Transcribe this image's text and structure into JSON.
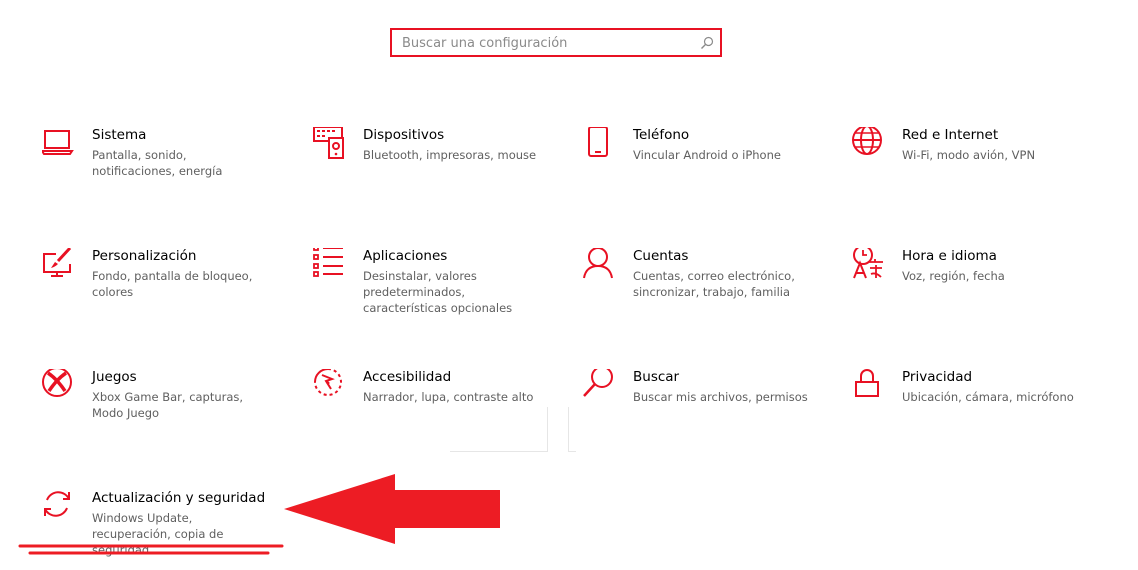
{
  "search": {
    "placeholder": "Buscar una configuración"
  },
  "colors": {
    "accent": "#e81123",
    "annotation": "#ed1c24"
  },
  "tiles": [
    {
      "title": "Sistema",
      "desc": "Pantalla, sonido, notificaciones, energía",
      "icon": "laptop-icon"
    },
    {
      "title": "Dispositivos",
      "desc": "Bluetooth, impresoras, mouse",
      "icon": "keyboard-speaker-icon"
    },
    {
      "title": "Teléfono",
      "desc": "Vincular Android o iPhone",
      "icon": "phone-icon"
    },
    {
      "title": "Red e Internet",
      "desc": "Wi-Fi, modo avión, VPN",
      "icon": "globe-icon"
    },
    {
      "title": "Personalización",
      "desc": "Fondo, pantalla de bloqueo, colores",
      "icon": "paint-screen-icon"
    },
    {
      "title": "Aplicaciones",
      "desc": "Desinstalar, valores predeterminados, características opcionales",
      "icon": "app-list-icon"
    },
    {
      "title": "Cuentas",
      "desc": "Cuentas, correo electrónico, sincronizar, trabajo, familia",
      "icon": "person-icon"
    },
    {
      "title": "Hora e idioma",
      "desc": "Voz, región, fecha",
      "icon": "time-language-icon"
    },
    {
      "title": "Juegos",
      "desc": "Xbox Game Bar, capturas, Modo Juego",
      "icon": "xbox-icon"
    },
    {
      "title": "Accesibilidad",
      "desc": "Narrador, lupa, contraste alto",
      "icon": "accessibility-icon"
    },
    {
      "title": "Buscar",
      "desc": "Buscar mis archivos, permisos",
      "icon": "search-icon"
    },
    {
      "title": "Privacidad",
      "desc": "Ubicación, cámara, micrófono",
      "icon": "lock-icon"
    },
    {
      "title": "Actualización y seguridad",
      "desc": "Windows Update, recuperación, copia de seguridad",
      "icon": "sync-icon"
    }
  ]
}
